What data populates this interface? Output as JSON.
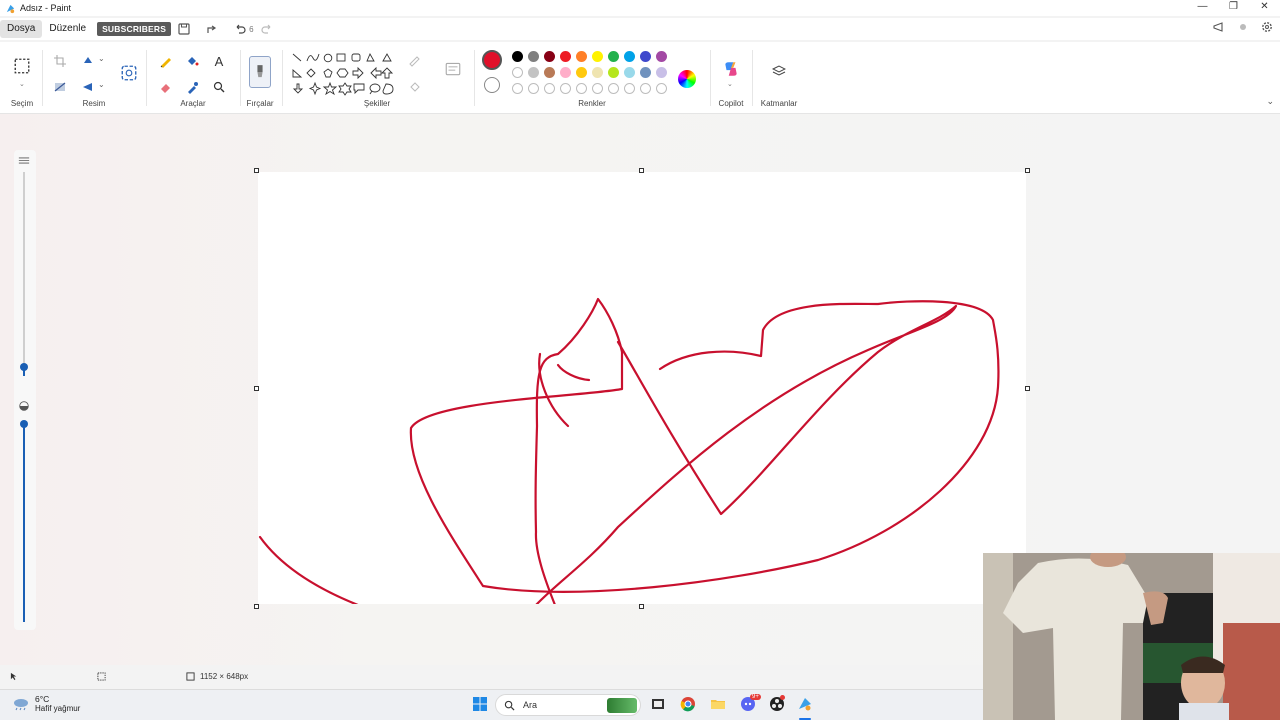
{
  "window": {
    "title": "Adsız - Paint",
    "controls": [
      "minimize",
      "restore",
      "close"
    ]
  },
  "menu": {
    "items": [
      "Dosya",
      "Düzenle"
    ],
    "overlay_banner": "SUBSCRIBERS",
    "undo_count": "6"
  },
  "ribbon": {
    "groups": {
      "selection": "Seçim",
      "image": "Resim",
      "tools": "Araçlar",
      "brushes": "Fırçalar",
      "shapes": "Şekiller",
      "colors": "Renkler",
      "copilot": "Copilot",
      "layers": "Katmanlar"
    },
    "text_tool_label": "A",
    "selected_color": "#e0102a",
    "secondary_color": "#ffffff",
    "palette_row1": [
      "#000000",
      "#7f7f7f",
      "#880015",
      "#ed1c24",
      "#ff7f27",
      "#fff200",
      "#22b14c",
      "#00a2e8",
      "#3f48cc",
      "#a349a4"
    ],
    "palette_row2": [
      "#ffffff",
      "#c3c3c3",
      "#b97a57",
      "#ffaec9",
      "#ffc90e",
      "#efe4b0",
      "#b5e61d",
      "#99d9ea",
      "#7092be",
      "#c8bfe7"
    ]
  },
  "status": {
    "canvas_size": "1152 × 648px"
  },
  "taskbar": {
    "weather_temp": "6°C",
    "weather_desc": "Hafif yağmur",
    "search_placeholder": "Ara",
    "notification_badge": "9+"
  },
  "drawing": {
    "stroke_color": "#c8102e"
  }
}
